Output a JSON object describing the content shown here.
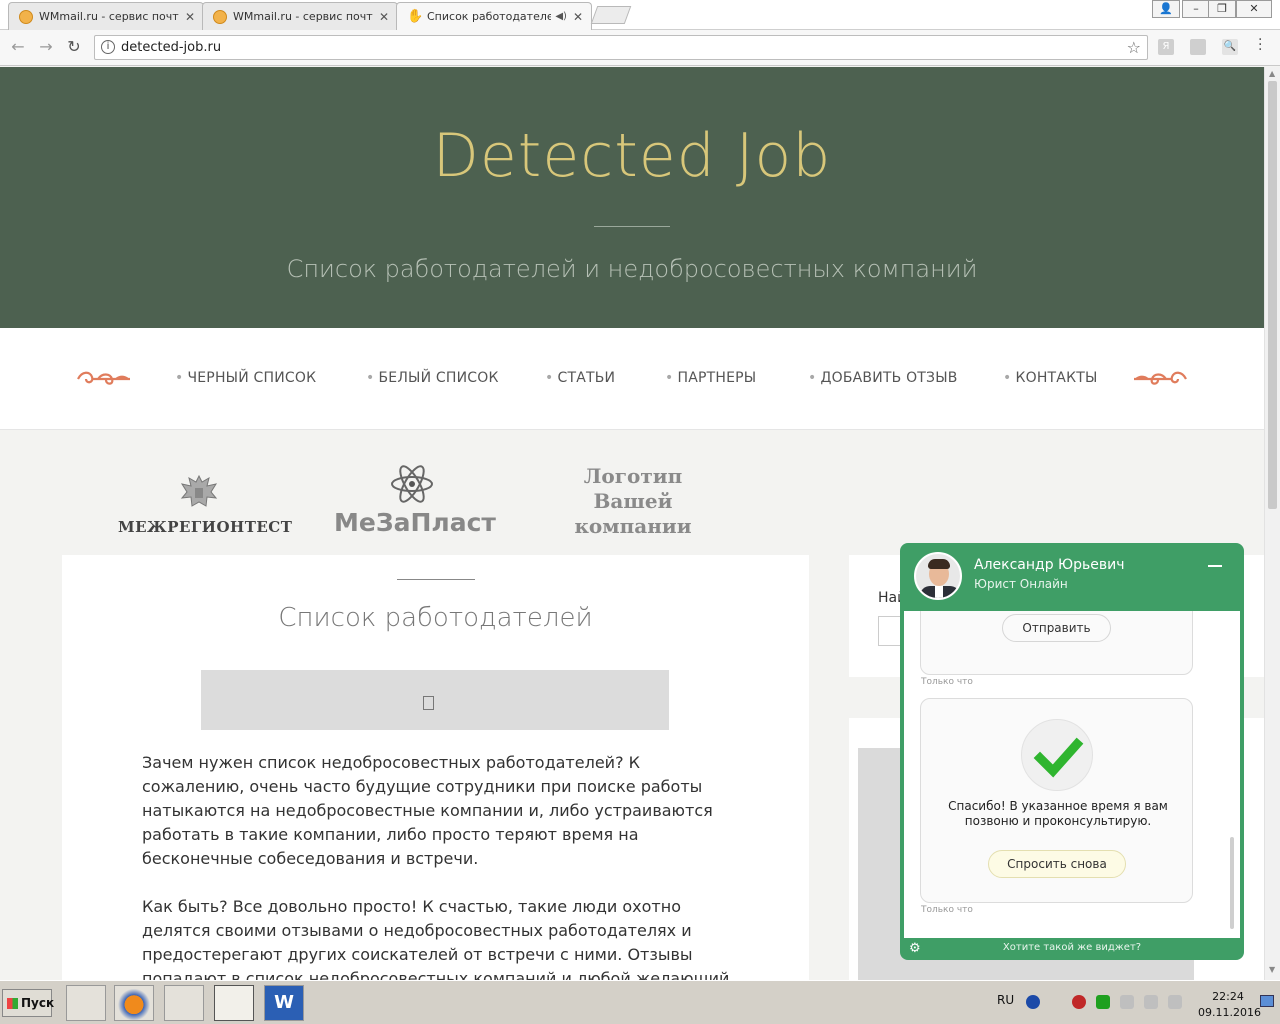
{
  "browser": {
    "tabs": [
      {
        "title": "WMmail.ru - сервис почтов",
        "active": false
      },
      {
        "title": "WMmail.ru - сервис почтов",
        "active": false
      },
      {
        "title": "Список работодателей",
        "active": true
      }
    ],
    "url": "detected-job.ru"
  },
  "site": {
    "title": "Detected Job",
    "subtitle": "Список работодателей и недобросовестных компаний",
    "nav": [
      "ЧЕРНЫЙ СПИСОК",
      "БЕЛЫЙ СПИСОК",
      "СТАТЬИ",
      "ПАРТНЕРЫ",
      "ДОБАВИТЬ ОТЗЫВ",
      "КОНТАКТЫ"
    ],
    "partners": {
      "logo1": "МЕЖРЕГИОНТЕСТ",
      "logo2": "МеЗаПласт",
      "logo3_l1": "Логотип",
      "logo3_l2": "Вашей",
      "logo3_l3": "компании"
    }
  },
  "article": {
    "heading": "Список работодателей",
    "p1": "Зачем нужен список недобросовестных работодателей? К сожалению, очень часто будущие сотрудники при поиске работы натыкаются на недобросовестные компании и, либо устраиваются работать в такие компании, либо просто теряют время на бесконечные собеседования и встречи.",
    "p2": "Как быть? Все довольно просто! К счастью, такие люди охотно делятся своими отзывами о недобросовестных работодателях и предостерегают других соискателей от встречи с ними. Отзывы попадают в список недобросовестных компаний и любой желающий может ознакомиться с"
  },
  "sidebar": {
    "search_label": "Най"
  },
  "chat": {
    "agent_name": "Александр Юрьевич",
    "agent_role": "Юрист Онлайн",
    "send_button": "Отправить",
    "time1": "Только что",
    "message": "Спасибо! В указанное время я вам позвоню и проконсультирую.",
    "ask_again": "Спросить снова",
    "time2": "Только что",
    "footer": "Хотите такой же виджет?",
    "colors": {
      "header": "#3f9e66",
      "check": "#2fb52f"
    }
  },
  "taskbar": {
    "start": "Пуск",
    "lang": "RU",
    "time": "22:24",
    "date": "09.11.2016"
  },
  "colors": {
    "header_bg": "#4d6150",
    "title_gold": "#d8c77a",
    "ornament": "#e07c5c"
  }
}
